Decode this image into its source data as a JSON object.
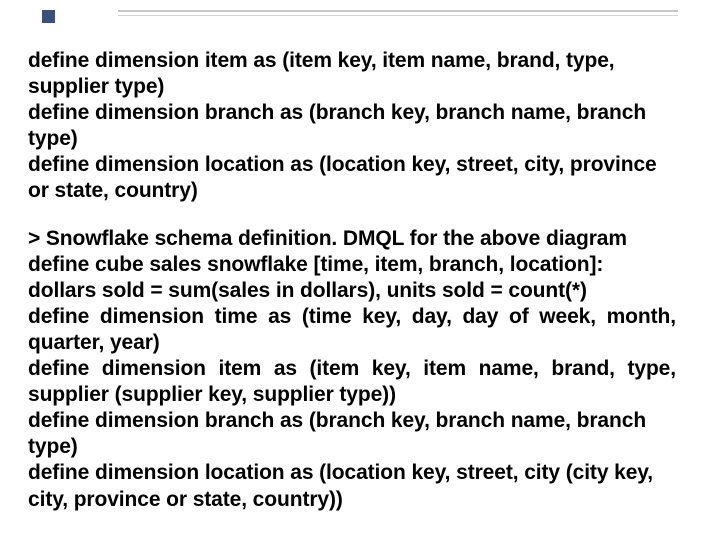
{
  "section1": {
    "p1": "define dimension item as (item key, item name, brand, type, supplier type)",
    "p2": "define dimension branch as (branch key, branch name, branch type)",
    "p3": "define dimension location as (location key, street, city, province or state, country)"
  },
  "section2": {
    "title": "> Snowflake schema definition. DMQL for the above diagram",
    "p1": "define cube sales snowflake [time, item, branch, location]:",
    "p2": "dollars sold = sum(sales in dollars), units sold = count(*)",
    "p3": "define dimension time as (time key, day, day of week, month, quarter, year)",
    "p4": "define dimension item as (item key, item name, brand, type, supplier (supplier key, supplier type))",
    "p5": "define dimension branch as (branch key, branch name, branch type)",
    "p6": "define dimension location as (location key, street, city (city key, city, province or state, country))"
  }
}
